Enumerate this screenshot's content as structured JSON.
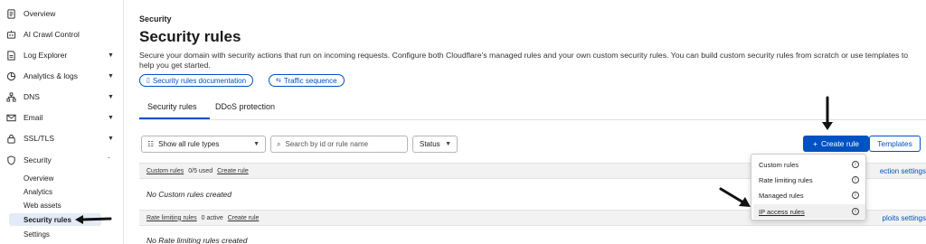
{
  "sidebar": {
    "items": [
      {
        "label": "Overview",
        "icon": "document-icon"
      },
      {
        "label": "AI Crawl Control",
        "icon": "bot-icon"
      },
      {
        "label": "Log Explorer",
        "icon": "log-icon",
        "expandable": true
      },
      {
        "label": "Analytics & logs",
        "icon": "chart-icon",
        "expandable": true
      },
      {
        "label": "DNS",
        "icon": "network-icon",
        "expandable": true
      },
      {
        "label": "Email",
        "icon": "email-icon",
        "expandable": true
      },
      {
        "label": "SSL/TLS",
        "icon": "lock-icon",
        "expandable": true
      },
      {
        "label": "Security",
        "icon": "shield-icon",
        "expandable": true,
        "expanded": true
      }
    ],
    "security_sub": [
      "Overview",
      "Analytics",
      "Web assets",
      "Security rules",
      "Settings"
    ],
    "active_sub": "Security rules"
  },
  "header": {
    "breadcrumb": "Security",
    "title": "Security rules",
    "description": "Secure your domain with security actions that run on incoming requests. Configure both Cloudflare's managed rules and your own custom security rules. You can build custom security rules from scratch or use templates to help you get started.",
    "links": [
      "Security rules documentation",
      "Traffic sequence"
    ]
  },
  "tabs": [
    "Security rules",
    "DDoS protection"
  ],
  "active_tab": "Security rules",
  "toolbar": {
    "rule_type_select": "Show all rule types",
    "search_placeholder": "Search by id or rule name",
    "status_label": "Status",
    "create_rule": "Create rule",
    "templates": "Templates"
  },
  "sections": [
    {
      "title": "Custom rules",
      "count": "0/5 used",
      "link": "Create rule",
      "empty": "No Custom rules created",
      "right_link": "ection settings"
    },
    {
      "title": "Rate limiting rules",
      "count": "0 active",
      "link": "Create rule",
      "empty": "No Rate limiting rules created",
      "right_link": "ploits settings"
    }
  ],
  "create_menu": {
    "items": [
      "Custom rules",
      "Rate limiting rules",
      "Managed rules",
      "IP access rules"
    ],
    "highlighted": "IP access rules"
  },
  "colors": {
    "accent": "#0051c3",
    "active_bg": "#e3ebf8",
    "section_bg": "#f2f2f2"
  }
}
